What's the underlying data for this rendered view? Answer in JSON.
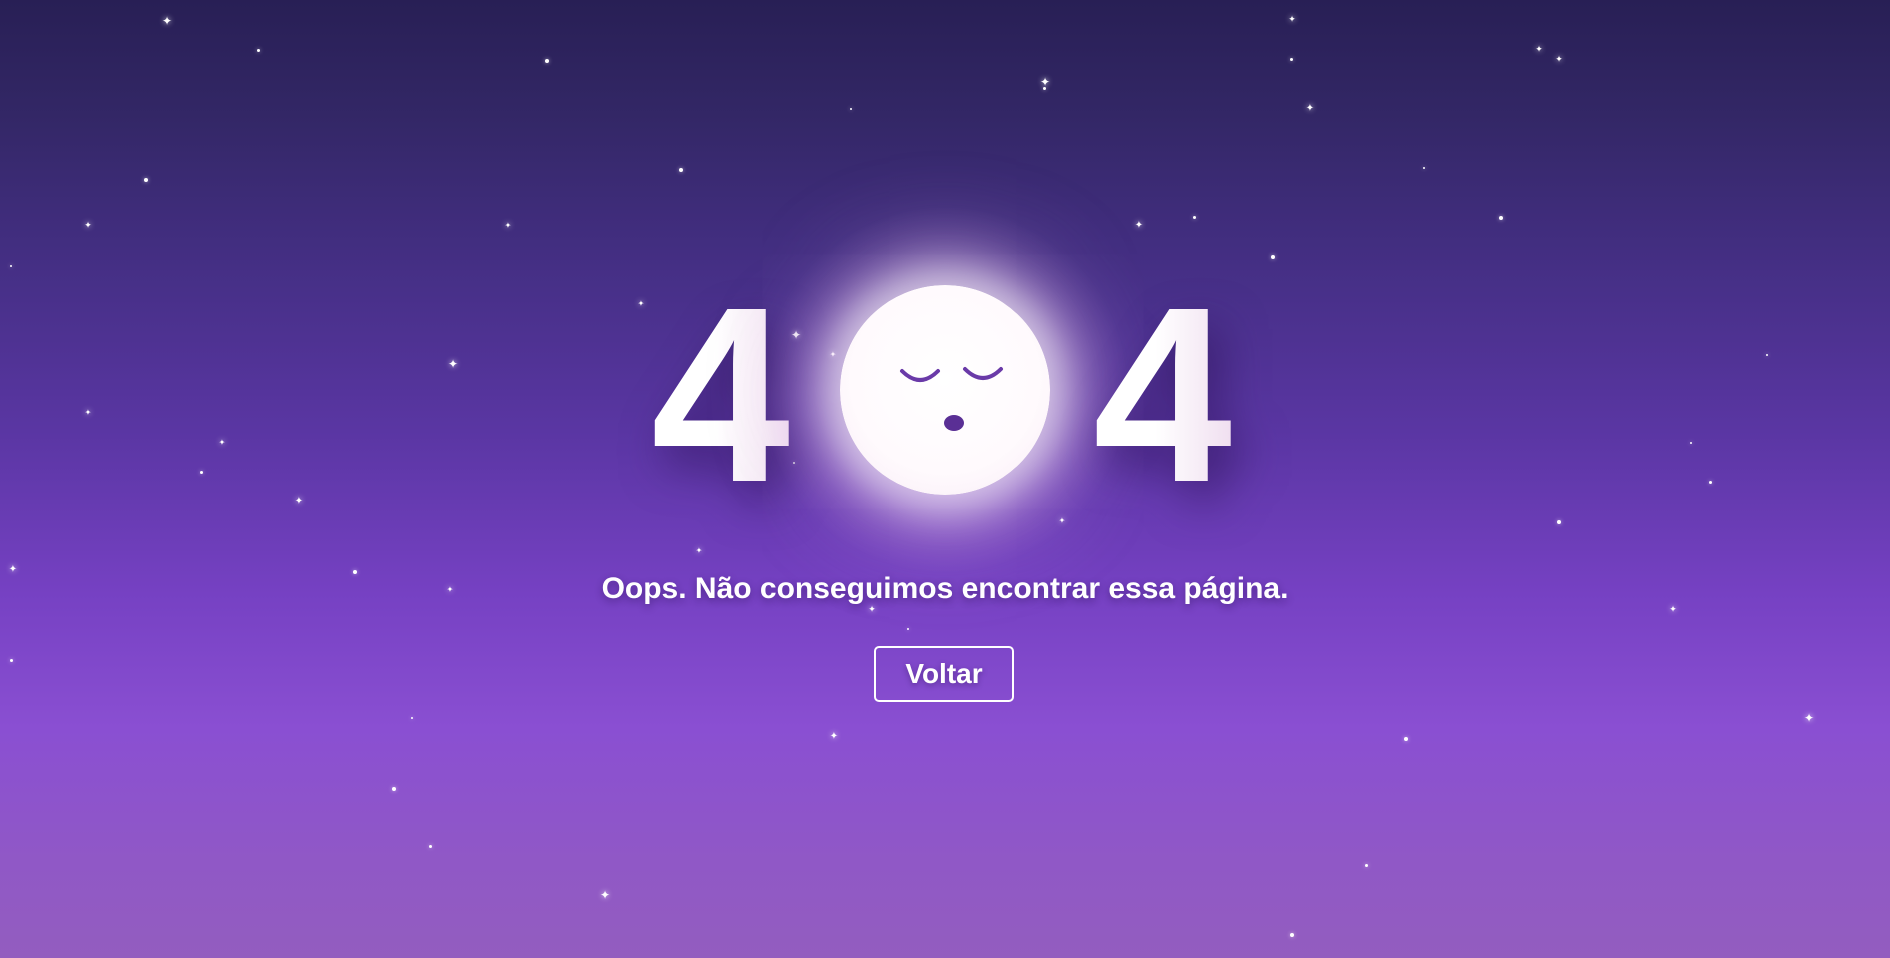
{
  "colors": {
    "background_top": "#281f55",
    "background_mid": "#7641c3",
    "background_bottom": "#935dbf",
    "moon": "#ffffff",
    "moon_face": "#6a3aa8",
    "text": "#ffffff"
  },
  "error_code": {
    "first_digit": "4",
    "last_digit": "4"
  },
  "moon": {
    "icon": "sleeping-moon-icon"
  },
  "message": "Oops. Não conseguimos encontrar essa página.",
  "back_button": {
    "label": "Voltar"
  }
}
